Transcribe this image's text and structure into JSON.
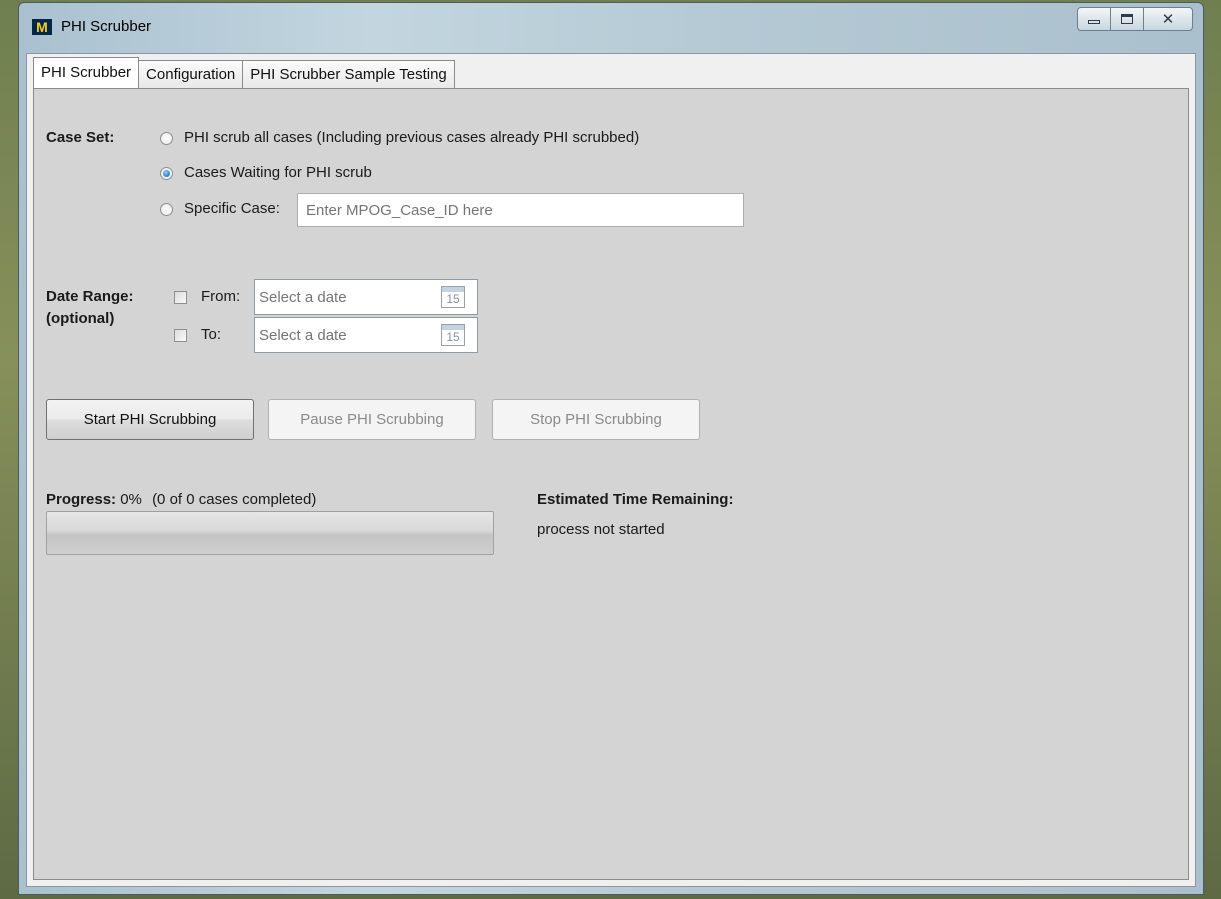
{
  "window": {
    "title": "PHI Scrubber",
    "app_icon_letter": "M"
  },
  "tabs": [
    {
      "label": "PHI Scrubber",
      "active": true
    },
    {
      "label": "Configuration",
      "active": false
    },
    {
      "label": "PHI Scrubber Sample Testing",
      "active": false
    }
  ],
  "case_set": {
    "label": "Case Set:",
    "options": [
      {
        "label": "PHI scrub all cases (Including previous cases already PHI scrubbed)",
        "selected": false
      },
      {
        "label": "Cases Waiting for PHI scrub",
        "selected": true
      },
      {
        "label": "Specific Case:",
        "selected": false
      }
    ],
    "specific_case_placeholder": "Enter MPOG_Case_ID here"
  },
  "date_range": {
    "label": "Date Range:",
    "sublabel": "(optional)",
    "from": {
      "label": "From:",
      "checked": false,
      "placeholder": "Select a date",
      "calendar_day": "15"
    },
    "to": {
      "label": "To:",
      "checked": false,
      "placeholder": "Select a date",
      "calendar_day": "15"
    }
  },
  "actions": {
    "start": {
      "label": "Start PHI Scrubbing",
      "enabled": true
    },
    "pause": {
      "label": "Pause PHI Scrubbing",
      "enabled": false
    },
    "stop": {
      "label": "Stop PHI Scrubbing",
      "enabled": false
    }
  },
  "progress": {
    "label": "Progress:",
    "percent_text": "0%",
    "detail": "(0 of 0 cases completed)",
    "value": 0
  },
  "eta": {
    "label": "Estimated Time Remaining:",
    "value": "process not started"
  },
  "icons": {
    "app": "university-m-logo-icon",
    "minimize": "minimize-icon",
    "maximize": "maximize-icon",
    "close": "close-icon",
    "calendar": "calendar-icon"
  },
  "colors": {
    "panel_background": "#d4d4d4",
    "radio_selected": "#2a8bd4"
  }
}
